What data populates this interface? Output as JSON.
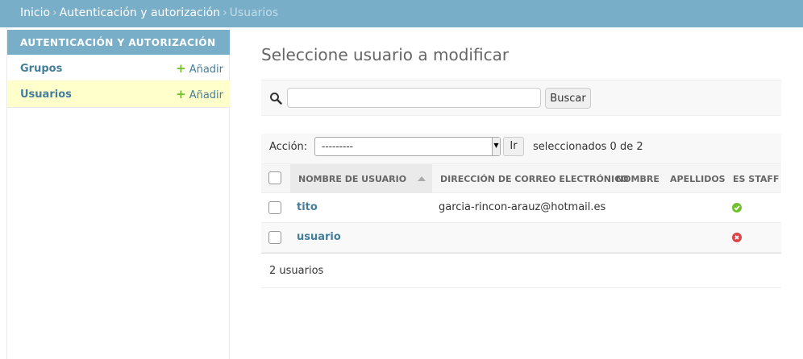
{
  "breadcrumbs": {
    "home": "Inicio",
    "section": "Autenticación y autorización",
    "current": "Usuarios",
    "separator": "›"
  },
  "sidebar": {
    "caption": "AUTENTICACIÓN Y AUTORIZACIÓN",
    "items": [
      {
        "label": "Grupos",
        "add_label": "Añadir",
        "selected": false
      },
      {
        "label": "Usuarios",
        "add_label": "Añadir",
        "selected": true
      }
    ],
    "add_icon": "plus-icon"
  },
  "page": {
    "title": "Seleccione usuario a modificar"
  },
  "search": {
    "button_label": "Buscar",
    "value": "",
    "icon": "search-icon"
  },
  "actions": {
    "label": "Acción:",
    "selected_option": "---------",
    "go_label": "Ir",
    "selection_count": "seleccionados 0 de 2"
  },
  "table": {
    "columns": [
      "NOMBRE DE USUARIO",
      "DIRECCIÓN DE CORREO ELECTRÓNICO",
      "NOMBRE",
      "APELLIDOS",
      "ES STAFF"
    ],
    "sorted_column": "NOMBRE DE USUARIO",
    "rows": [
      {
        "username": "tito",
        "email": "garcia-rincon-arauz@hotmail.es",
        "first_name": "",
        "last_name": "",
        "is_staff": true
      },
      {
        "username": "usuario",
        "email": "",
        "first_name": "",
        "last_name": "",
        "is_staff": false
      }
    ]
  },
  "footer": {
    "count": "2 usuarios"
  },
  "colors": {
    "header_bg": "#79aec8",
    "link": "#447e9b",
    "add_green": "#70bf2b",
    "selected_row": "#ffffcc",
    "yes_icon": "#70bf2b",
    "no_icon": "#dd4646"
  }
}
